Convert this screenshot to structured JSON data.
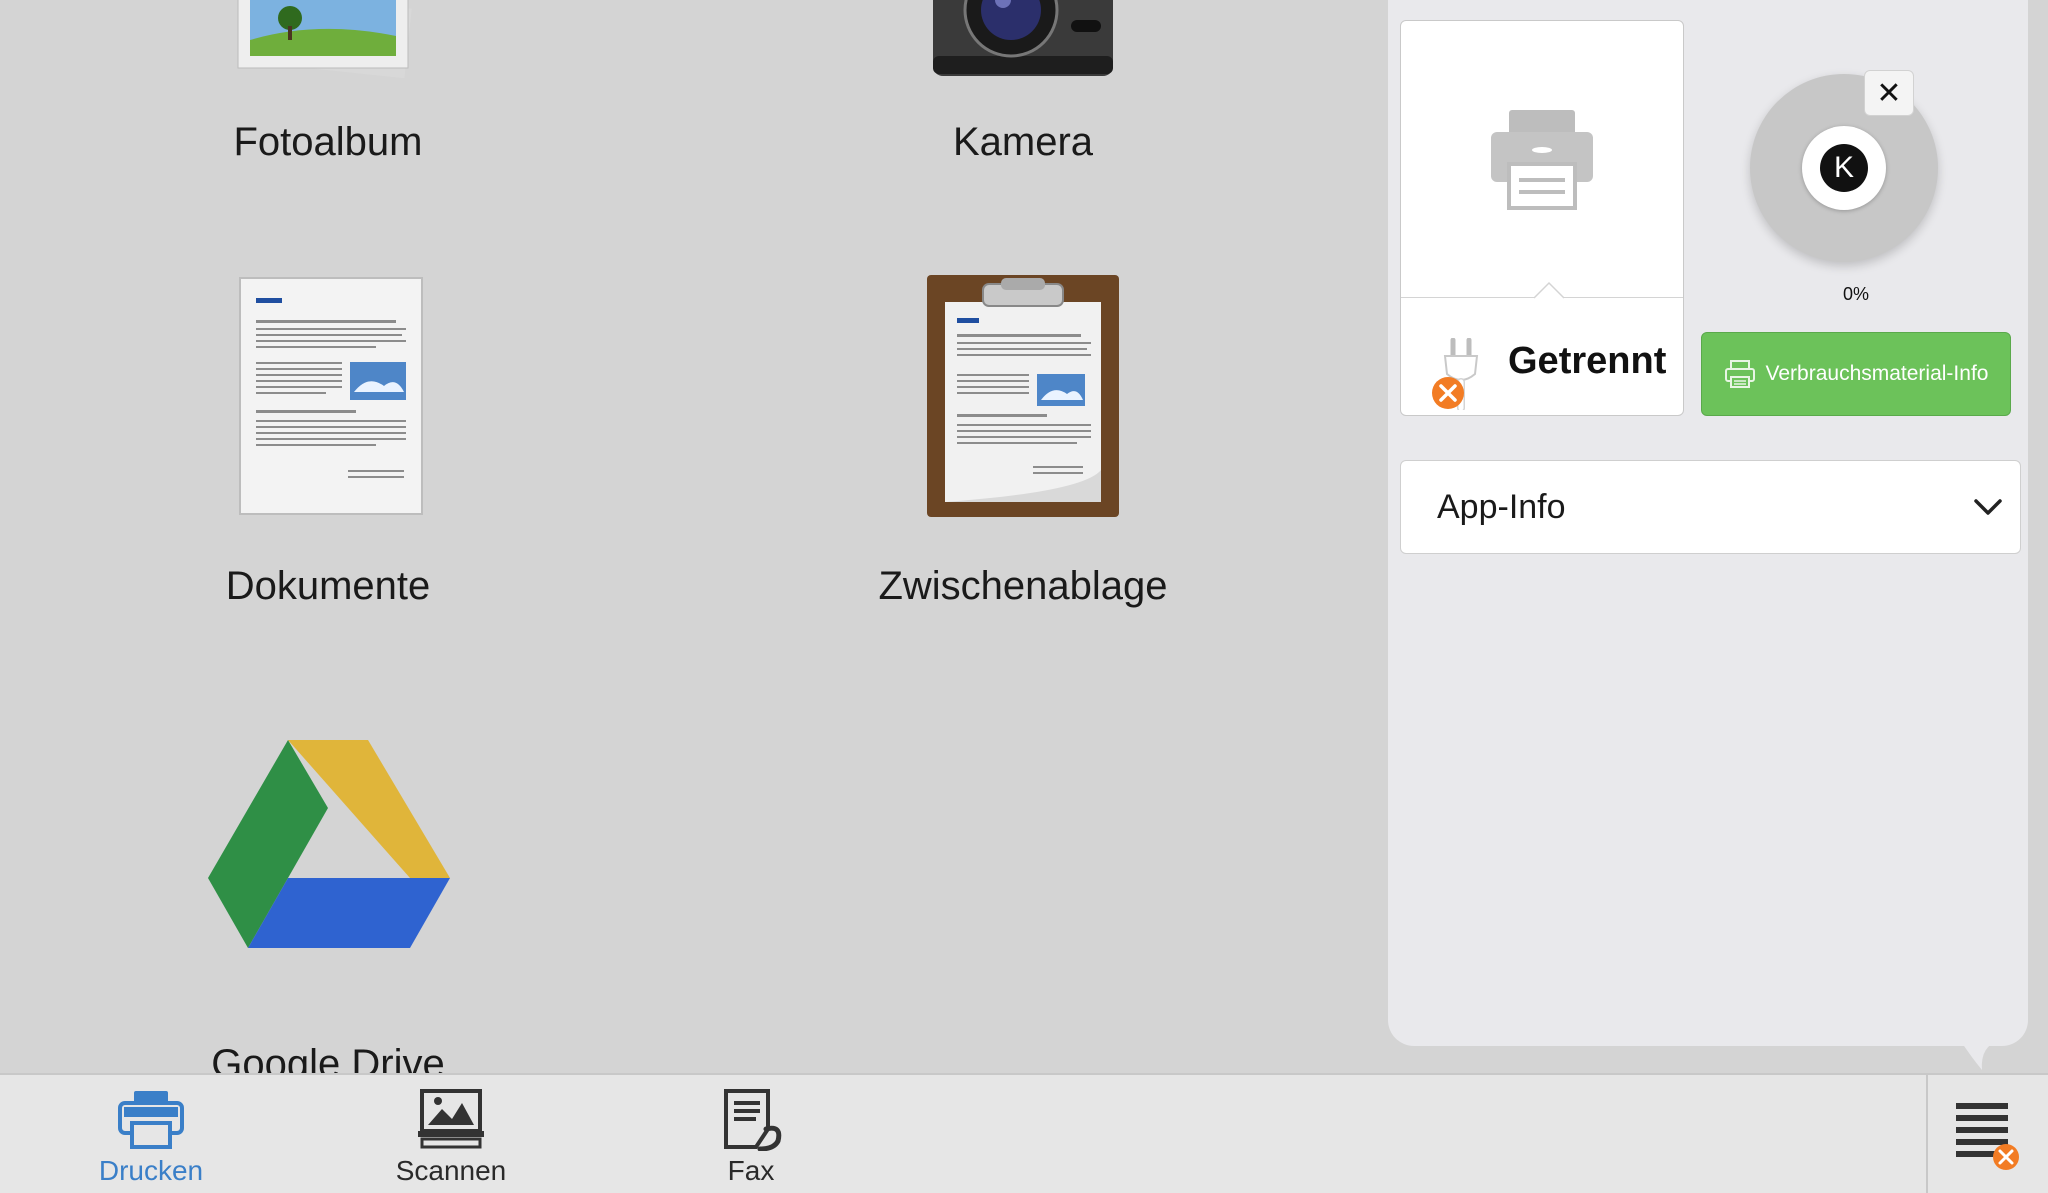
{
  "sources": {
    "fotoalbum": "Fotoalbum",
    "kamera": "Kamera",
    "dokumente": "Dokumente",
    "zwischenablage": "Zwischenablage",
    "google_drive": "Google Drive"
  },
  "printer": {
    "status": "Getrennt",
    "status_icon": "unplugged-plug-icon",
    "error_badge_color": "#f27c24"
  },
  "toner": {
    "letter": "K",
    "level_percent": "0%"
  },
  "supply_button": {
    "label": "Verbrauchsmaterial-Info",
    "color": "#6cc25a"
  },
  "app_info": {
    "label": "App-Info"
  },
  "toolbar": {
    "tabs": [
      {
        "label": "Drucken",
        "icon": "printer-icon",
        "active": true
      },
      {
        "label": "Scannen",
        "icon": "scanner-icon",
        "active": false
      },
      {
        "label": "Fax",
        "icon": "fax-icon",
        "active": false
      }
    ],
    "accent_color": "#3a7fc8"
  }
}
